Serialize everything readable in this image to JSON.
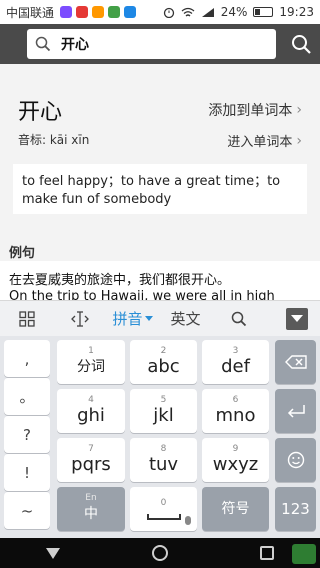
{
  "status": {
    "carrier": "中国联通",
    "battery": "24%",
    "time": "19:23"
  },
  "search": {
    "query": "开心"
  },
  "entry": {
    "word": "开心",
    "add_label": "添加到单词本",
    "phonetic": "音标: kāi xīn",
    "enter_label": "进入单词本",
    "definition": "to feel happy；to have a great time；to make fun of somebody"
  },
  "examples": {
    "title": "例句",
    "cn": "在去夏威夷的旅途中，我们都很开心。",
    "en": "On the trip to Hawaii, we were all in high spirits."
  },
  "toolbar": {
    "pinyin": "拼音",
    "english": "英文"
  },
  "keyboard": {
    "punct": [
      ",",
      "。",
      "?",
      "!",
      "~"
    ],
    "row1": [
      {
        "num": "1",
        "label": "分词"
      },
      {
        "num": "2",
        "label": "abc"
      },
      {
        "num": "3",
        "label": "def"
      }
    ],
    "row2": [
      {
        "num": "4",
        "label": "ghi"
      },
      {
        "num": "5",
        "label": "jkl"
      },
      {
        "num": "6",
        "label": "mno"
      }
    ],
    "row3": [
      {
        "num": "7",
        "label": "pqrs"
      },
      {
        "num": "8",
        "label": "tuv"
      },
      {
        "num": "9",
        "label": "wxyz"
      }
    ],
    "bottom": {
      "lang_sup": "En",
      "lang": "中",
      "zero": "0",
      "symbols": "符号",
      "num_mode": "123"
    }
  },
  "colors": {
    "accent": "#2a8fd6",
    "header": "#4a4a4a",
    "nav": "#0b0b0b"
  }
}
